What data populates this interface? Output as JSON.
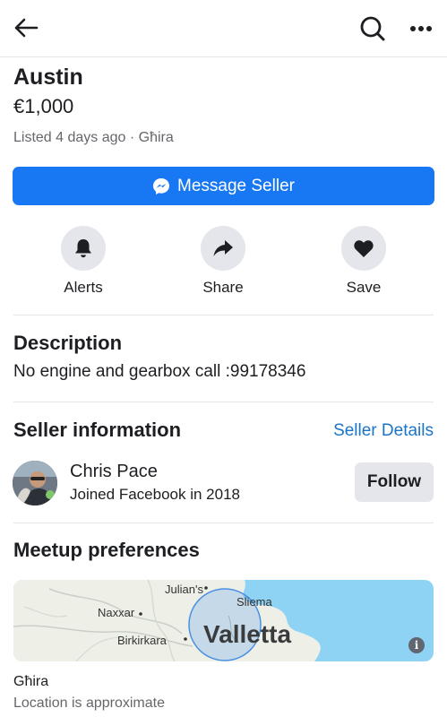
{
  "listing": {
    "title": "Austin",
    "price": "€1,000",
    "listed": "Listed 4 days ago · Għira"
  },
  "message_button": {
    "label": "Message Seller",
    "icon": "messenger-icon"
  },
  "actions": [
    {
      "label": "Alerts",
      "icon": "bell-icon"
    },
    {
      "label": "Share",
      "icon": "share-arrow-icon"
    },
    {
      "label": "Save",
      "icon": "heart-icon"
    }
  ],
  "description": {
    "heading": "Description",
    "text": "No engine and gearbox call :99178346"
  },
  "seller": {
    "heading": "Seller information",
    "details_link": "Seller Details",
    "name": "Chris Pace",
    "joined": "Joined Facebook in 2018",
    "follow_label": "Follow"
  },
  "meetup": {
    "heading": "Meetup preferences",
    "map_labels": {
      "julians": "Julian's",
      "sliema": "Sliema",
      "naxxar": "Naxxar",
      "birkirkara": "Birkirkara",
      "valletta": "Valletta"
    },
    "info": "i",
    "location": "Għira",
    "note": "Location is approximate"
  },
  "colors": {
    "primary_blue": "#1877f2",
    "link_blue": "#1a75c9",
    "gray_button": "#e4e6eb",
    "sea": "#8fd3f4"
  }
}
